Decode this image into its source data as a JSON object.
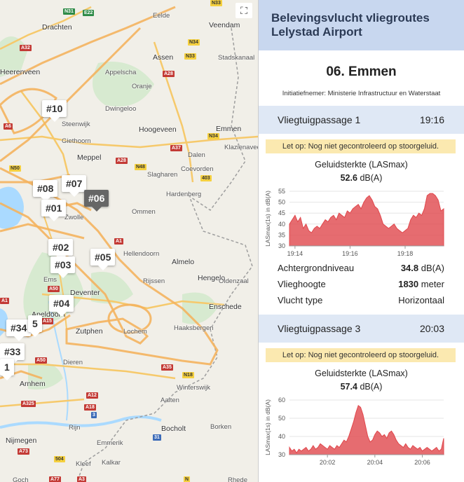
{
  "map": {
    "fullscreen_icon": "fullscreen-icon",
    "places": [
      {
        "name": "Drachten",
        "big": true
      },
      {
        "name": "Heerenveen",
        "big": true
      },
      {
        "name": "Eelde"
      },
      {
        "name": "Veendam",
        "big": true
      },
      {
        "name": "Assen",
        "big": true
      },
      {
        "name": "Stadskanaal"
      },
      {
        "name": "Appelscha"
      },
      {
        "name": "Oranje"
      },
      {
        "name": "Dwingeloo"
      },
      {
        "name": "Steenwijk"
      },
      {
        "name": "Giethoorn"
      },
      {
        "name": "Hoogeveen",
        "big": true
      },
      {
        "name": "Emmen",
        "big": true
      },
      {
        "name": "Klazienaveen"
      },
      {
        "name": "Meppel",
        "big": true
      },
      {
        "name": "Dalen"
      },
      {
        "name": "Coevorden"
      },
      {
        "name": "Slagharen"
      },
      {
        "name": "Hardenberg"
      },
      {
        "name": "Ommen"
      },
      {
        "name": "Hellendoorn"
      },
      {
        "name": "Almelo",
        "big": true
      },
      {
        "name": "Rijssen"
      },
      {
        "name": "Hengelo",
        "big": true
      },
      {
        "name": "Oldenzaal"
      },
      {
        "name": "Enschede",
        "big": true
      },
      {
        "name": "Deventer",
        "big": true
      },
      {
        "name": "Apeldoorn",
        "big": true
      },
      {
        "name": "Zutphen",
        "big": true
      },
      {
        "name": "Lochem"
      },
      {
        "name": "Haaksbergen"
      },
      {
        "name": "Dieren"
      },
      {
        "name": "Arnhem",
        "big": true
      },
      {
        "name": "Winterswijk"
      },
      {
        "name": "Aalten"
      },
      {
        "name": "Bocholt",
        "big": true
      },
      {
        "name": "Borken"
      },
      {
        "name": "Emmerik"
      },
      {
        "name": "Nijmegen",
        "big": true
      },
      {
        "name": "Kleef"
      },
      {
        "name": "Kalkar"
      },
      {
        "name": "Goch"
      },
      {
        "name": "Rhede"
      },
      {
        "name": "Rijn"
      },
      {
        "name": "Ems"
      },
      {
        "name": "Zwolle"
      }
    ],
    "shields": [
      "N31",
      "E22",
      "N33",
      "A32",
      "N34",
      "N33",
      "A28",
      "A6",
      "N34",
      "A37",
      "A28",
      "N48",
      "N50",
      "403",
      "A1",
      "A35",
      "A50",
      "A1",
      "N18",
      "A15",
      "A50",
      "A12",
      "A325",
      "A18",
      "3",
      "31",
      "A73",
      "504",
      "A77",
      "A3",
      "N"
    ],
    "markers": [
      "#10",
      "#07",
      "#08",
      "#06",
      "#01",
      "#02",
      "#03",
      "#05",
      "#04",
      "#34",
      "#33",
      "1",
      "5"
    ]
  },
  "panel": {
    "title": "Belevingsvlucht vliegroutes Lelystad Airport",
    "location": "06. Emmen",
    "initiator": "Initiatiefnemer: Ministerie Infrastructuur en Waterstaat",
    "passages": [
      {
        "name": "Vliegtuigpassage 1",
        "time": "19:16",
        "warning": "Let op: Nog niet gecontroleerd op stoorgeluid.",
        "graph_title": "Geluidsterkte (LASmax)",
        "value": "52.6",
        "unit": "dB(A)",
        "stats": [
          {
            "label": "Achtergrondniveau",
            "value": "34.8",
            "unit": "dB(A)"
          },
          {
            "label": "Vlieghoogte",
            "value": "1830",
            "unit": "meter"
          },
          {
            "label": "Vlucht type",
            "value": "",
            "unit": "Horizontaal"
          }
        ]
      },
      {
        "name": "Vliegtuigpassage 3",
        "time": "20:03",
        "warning": "Let op: Nog niet gecontroleerd op stoorgeluid.",
        "graph_title": "Geluidsterkte (LASmax)",
        "value": "57.4",
        "unit": "dB(A)",
        "stats": []
      }
    ]
  },
  "chart_data": [
    {
      "type": "area",
      "ylabel": "LASmax(1s) in dB(A)",
      "ylim": [
        30,
        55
      ],
      "yticks": [
        30,
        35,
        40,
        45,
        50,
        55
      ],
      "xticks": [
        "19:14",
        "19:16",
        "19:18"
      ],
      "xtick_minutes": [
        0,
        2,
        4
      ],
      "xlim_minutes": [
        -0.2,
        5.4
      ],
      "color": "#e0474c",
      "series": [
        {
          "x_minutes": [
            -0.2,
            -0.1,
            0,
            0.1,
            0.2,
            0.3,
            0.4,
            0.5,
            0.6,
            0.7,
            0.8,
            0.9,
            1,
            1.1,
            1.2,
            1.3,
            1.4,
            1.5,
            1.6,
            1.7,
            1.8,
            1.9,
            2,
            2.1,
            2.2,
            2.3,
            2.4,
            2.5,
            2.6,
            2.7,
            2.8,
            2.9,
            3,
            3.1,
            3.2,
            3.3,
            3.4,
            3.5,
            3.6,
            3.7,
            3.8,
            3.9,
            4,
            4.1,
            4.2,
            4.3,
            4.4,
            4.5,
            4.6,
            4.7,
            4.8,
            4.9,
            5,
            5.1,
            5.2,
            5.3,
            5.4
          ],
          "values": [
            40,
            42,
            44,
            41,
            43,
            38,
            40,
            37,
            36,
            38,
            39,
            38,
            40,
            42,
            41,
            43,
            44,
            42,
            45,
            44,
            43,
            46,
            45,
            47,
            48,
            49,
            47,
            50,
            52,
            53,
            51,
            48,
            47,
            44,
            40,
            39,
            38,
            39,
            40,
            38,
            37,
            36,
            37,
            38,
            42,
            44,
            43,
            45,
            44,
            47,
            53,
            54,
            54,
            53,
            51,
            46,
            47
          ]
        }
      ]
    },
    {
      "type": "area",
      "ylabel": "LASmax(1s) in dB(A)",
      "ylim": [
        30,
        60
      ],
      "yticks": [
        30,
        40,
        50,
        60
      ],
      "xticks": [
        "20:02",
        "20:04",
        "20:06"
      ],
      "xtick_minutes": [
        0,
        2,
        4
      ],
      "xlim_minutes": [
        -1.6,
        4.9
      ],
      "color": "#e0474c",
      "series": [
        {
          "x_minutes": [
            -1.6,
            -1.5,
            -1.4,
            -1.3,
            -1.2,
            -1.1,
            -1,
            -0.9,
            -0.8,
            -0.7,
            -0.6,
            -0.5,
            -0.4,
            -0.3,
            -0.2,
            -0.1,
            0,
            0.1,
            0.2,
            0.3,
            0.4,
            0.5,
            0.6,
            0.7,
            0.8,
            0.9,
            1,
            1.1,
            1.2,
            1.3,
            1.4,
            1.5,
            1.6,
            1.7,
            1.8,
            1.9,
            2,
            2.1,
            2.2,
            2.3,
            2.4,
            2.5,
            2.6,
            2.7,
            2.8,
            2.9,
            3,
            3.1,
            3.2,
            3.3,
            3.4,
            3.5,
            3.6,
            3.7,
            3.8,
            3.9,
            4,
            4.1,
            4.2,
            4.3,
            4.4,
            4.5,
            4.6,
            4.7,
            4.8,
            4.9
          ],
          "values": [
            34,
            32,
            33,
            31,
            33,
            32,
            33,
            34,
            32,
            33,
            35,
            33,
            34,
            36,
            35,
            34,
            33,
            35,
            34,
            33,
            35,
            34,
            36,
            38,
            37,
            40,
            44,
            48,
            53,
            57,
            56,
            52,
            46,
            40,
            37,
            38,
            41,
            43,
            42,
            40,
            41,
            39,
            42,
            43,
            41,
            38,
            36,
            35,
            34,
            36,
            34,
            33,
            35,
            34,
            33,
            34,
            32,
            33,
            34,
            33,
            32,
            33,
            34,
            32,
            33,
            39
          ]
        }
      ]
    }
  ]
}
